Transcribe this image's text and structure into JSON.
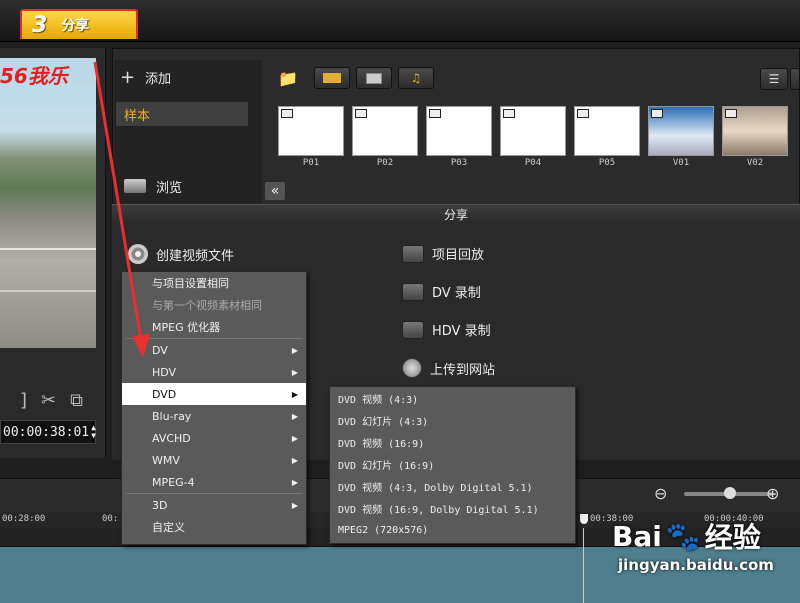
{
  "step_tab": {
    "number": "3",
    "label": "分享"
  },
  "preview": {
    "logo_text": "56我乐",
    "timecode": "00:00:38:01"
  },
  "library": {
    "add_label": "添加",
    "sample_label": "样本",
    "browse_label": "浏览",
    "thumbnails": [
      {
        "label": "P01"
      },
      {
        "label": "P02"
      },
      {
        "label": "P03"
      },
      {
        "label": "P04"
      },
      {
        "label": "P05"
      },
      {
        "label": "V01"
      },
      {
        "label": "V02"
      }
    ]
  },
  "share": {
    "header": "分享",
    "create_video": "创建视频文件",
    "project_playback": "项目回放",
    "dv_record": "DV 录制",
    "hdv_record": "HDV 录制",
    "upload_web": "上传到网站"
  },
  "menu": {
    "same_as_project": "与项目设置相同",
    "same_as_first_clip": "与第一个视频素材相同",
    "mpeg_optimizer": "MPEG 优化器",
    "dv": "DV",
    "hdv": "HDV",
    "dvd": "DVD",
    "bluray": "Blu-ray",
    "avchd": "AVCHD",
    "wmv": "WMV",
    "mpeg4": "MPEG-4",
    "three_d": "3D",
    "custom": "自定义"
  },
  "submenu": [
    "DVD 视频 (4:3)",
    "DVD 幻灯片 (4:3)",
    "DVD 视频 (16:9)",
    "DVD 幻灯片 (16:9)",
    "DVD 视频 (4:3, Dolby Digital 5.1)",
    "DVD 视频 (16:9, Dolby Digital 5.1)",
    "MPEG2 (720x576)"
  ],
  "timeline": {
    "ticks": [
      "00:28:00",
      "00:",
      "00:38:00",
      "00:00:40:00"
    ]
  },
  "watermark": {
    "brand": "Bai",
    "brand2": "经验",
    "url": "jingyan.baidu.com"
  }
}
